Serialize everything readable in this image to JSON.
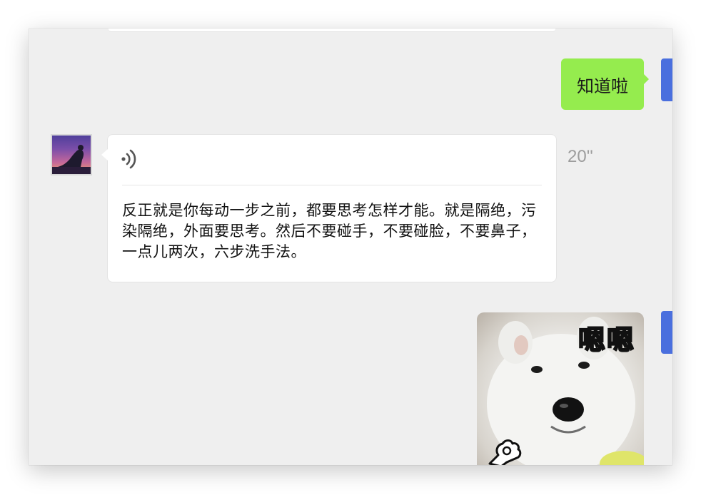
{
  "messages": {
    "outgoing_text": "知道啦",
    "voice": {
      "duration": "20''",
      "transcript": "反正就是你每动一步之前，都要思考怎样才能。就是隔绝，污染隔绝，外面要思考。然后不要碰手，不要碰脸，不要鼻子，一点儿两次，六步洗手法。"
    },
    "sticker": {
      "caption": "嗯嗯"
    }
  },
  "colors": {
    "outgoing_bubble": "#95ec4e",
    "incoming_bubble": "#ffffff",
    "background": "#efefef",
    "accent": "#4a6fde"
  }
}
